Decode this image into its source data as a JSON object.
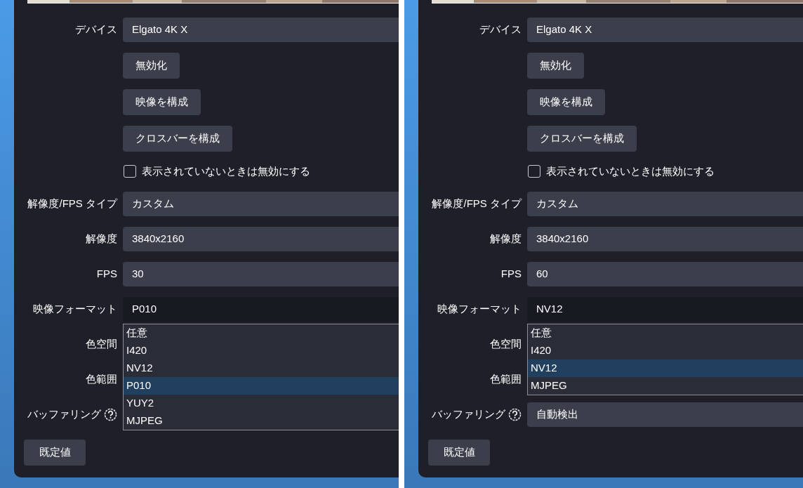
{
  "panels": [
    {
      "rows": [
        {
          "kind": "select",
          "label": "デバイス",
          "value": "Elgato 4K X"
        },
        {
          "kind": "button",
          "label": "無効化"
        },
        {
          "kind": "button",
          "label": "映像を構成"
        },
        {
          "kind": "button",
          "label": "クロスバーを構成"
        },
        {
          "kind": "checkbox",
          "label": "表示されていないときは無効にする",
          "checked": false
        },
        {
          "kind": "select",
          "label": "解像度/FPS タイプ",
          "value": "カスタム"
        },
        {
          "kind": "select",
          "label": "解像度",
          "value": "3840x2160"
        },
        {
          "kind": "select",
          "label": "FPS",
          "value": "30"
        },
        {
          "kind": "combo",
          "label": "映像フォーマット",
          "value": "P010",
          "options": [
            {
              "label": "任意",
              "selected": false
            },
            {
              "label": "I420",
              "selected": false
            },
            {
              "label": "NV12",
              "selected": false
            },
            {
              "label": "P010",
              "selected": true
            },
            {
              "label": "YUY2",
              "selected": false
            },
            {
              "label": "MJPEG",
              "selected": false
            }
          ]
        },
        {
          "kind": "covered",
          "label": "色空間"
        },
        {
          "kind": "covered",
          "label": "色範囲"
        },
        {
          "kind": "covered",
          "label": "バッファリング",
          "help": true
        }
      ],
      "footer_button": "既定値"
    },
    {
      "rows": [
        {
          "kind": "select",
          "label": "デバイス",
          "value": "Elgato 4K X"
        },
        {
          "kind": "button",
          "label": "無効化"
        },
        {
          "kind": "button",
          "label": "映像を構成"
        },
        {
          "kind": "button",
          "label": "クロスバーを構成"
        },
        {
          "kind": "checkbox",
          "label": "表示されていないときは無効にする",
          "checked": false
        },
        {
          "kind": "select",
          "label": "解像度/FPS タイプ",
          "value": "カスタム"
        },
        {
          "kind": "select",
          "label": "解像度",
          "value": "3840x2160"
        },
        {
          "kind": "select",
          "label": "FPS",
          "value": "60"
        },
        {
          "kind": "combo",
          "label": "映像フォーマット",
          "value": "NV12",
          "options": [
            {
              "label": "任意",
              "selected": false
            },
            {
              "label": "I420",
              "selected": false
            },
            {
              "label": "NV12",
              "selected": true
            },
            {
              "label": "MJPEG",
              "selected": false
            }
          ]
        },
        {
          "kind": "covered",
          "label": "色空間"
        },
        {
          "kind": "covered",
          "label": "色範囲"
        },
        {
          "kind": "select",
          "label": "バッファリング",
          "help": true,
          "value": "自動検出"
        }
      ],
      "footer_button": "既定値"
    }
  ]
}
